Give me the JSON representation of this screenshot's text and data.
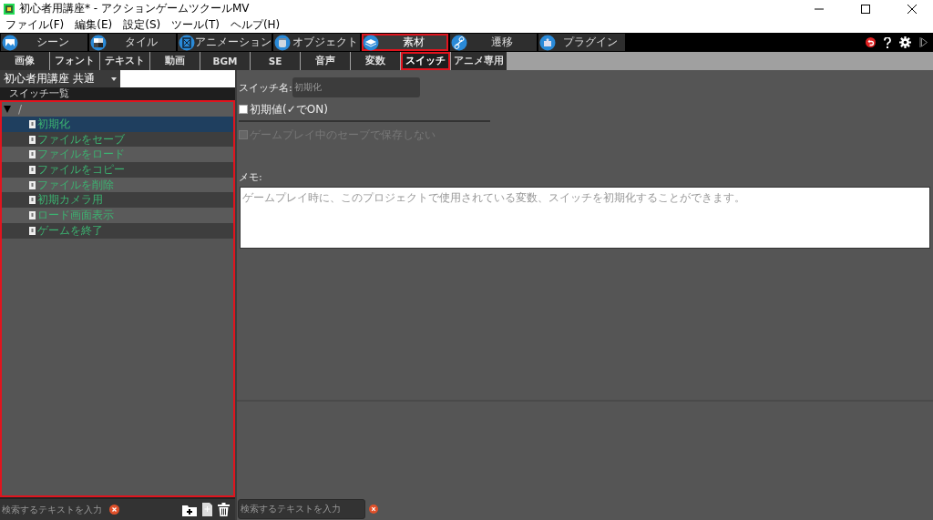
{
  "window": {
    "title": "初心者用講座* - アクションゲームツクールMV"
  },
  "menu": [
    "ファイル(F)",
    "編集(E)",
    "設定(S)",
    "ツール(T)",
    "ヘルプ(H)"
  ],
  "main_tabs": [
    {
      "label": "シーン",
      "selected": false,
      "highlighted": false
    },
    {
      "label": "タイル",
      "selected": false,
      "highlighted": false
    },
    {
      "label": "アニメーション",
      "selected": false,
      "highlighted": false
    },
    {
      "label": "オブジェクト",
      "selected": false,
      "highlighted": false
    },
    {
      "label": "素材",
      "selected": true,
      "highlighted": true
    },
    {
      "label": "遷移",
      "selected": false,
      "highlighted": false
    },
    {
      "label": "プラグイン",
      "selected": false,
      "highlighted": false
    }
  ],
  "sub_tabs": [
    {
      "label": "画像",
      "selected": false,
      "highlighted": false
    },
    {
      "label": "フォント",
      "selected": false,
      "highlighted": false
    },
    {
      "label": "テキスト",
      "selected": false,
      "highlighted": false
    },
    {
      "label": "動画",
      "selected": false,
      "highlighted": false
    },
    {
      "label": "BGM",
      "selected": false,
      "highlighted": false
    },
    {
      "label": "SE",
      "selected": false,
      "highlighted": false
    },
    {
      "label": "音声",
      "selected": false,
      "highlighted": false
    },
    {
      "label": "変数",
      "selected": false,
      "highlighted": false
    },
    {
      "label": "スイッチ",
      "selected": true,
      "highlighted": true
    },
    {
      "label": "アニメ専用",
      "selected": false,
      "highlighted": false
    }
  ],
  "project_select": {
    "value": "初心者用講座 共通"
  },
  "switch_list": {
    "title": "スイッチ一覧",
    "highlighted": true,
    "root": {
      "label": "/",
      "expanded": true,
      "children": [
        {
          "label": "初期化",
          "selected": true
        },
        {
          "label": "ファイルをセーブ",
          "selected": false
        },
        {
          "label": "ファイルをロード",
          "selected": false
        },
        {
          "label": "ファイルをコピー",
          "selected": false
        },
        {
          "label": "ファイルを削除",
          "selected": false
        },
        {
          "label": "初期カメラ用",
          "selected": false
        },
        {
          "label": "ロード画面表示",
          "selected": false
        },
        {
          "label": "ゲームを終了",
          "selected": false
        }
      ]
    }
  },
  "editor": {
    "name_label": "スイッチ名:",
    "name_value": "初期化",
    "options": [
      {
        "label": "初期値(✓でON)",
        "checked": false,
        "disabled": false
      },
      {
        "label": "ゲームプレイ中のセーブで保存しない",
        "checked": false,
        "disabled": true
      }
    ],
    "memo_label": "メモ:",
    "memo_value": "ゲームプレイ時に、このプロジェクトで使用されている変数、スイッチを初期化することができます。"
  },
  "search_fields": [
    {
      "placeholder": "検索するテキストを入力"
    },
    {
      "placeholder": "検索するテキストを入力"
    }
  ]
}
